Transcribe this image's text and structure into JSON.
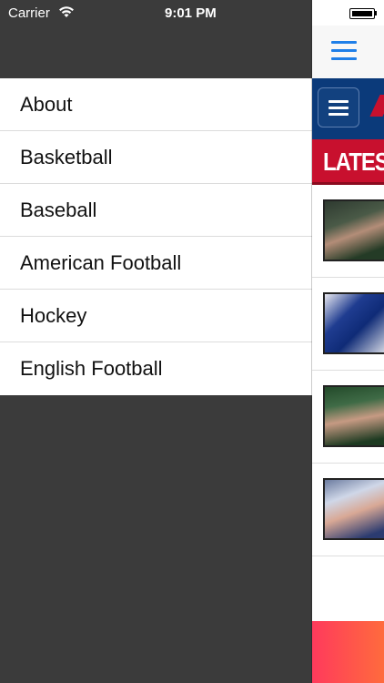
{
  "status_bar": {
    "carrier": "Carrier",
    "time": "9:01 PM"
  },
  "menu": {
    "items": [
      {
        "label": "About"
      },
      {
        "label": "Basketball"
      },
      {
        "label": "Baseball"
      },
      {
        "label": "American Football"
      },
      {
        "label": "Hockey"
      },
      {
        "label": "English Football"
      }
    ]
  },
  "preview": {
    "section_title": "LATEST",
    "colors": {
      "team_blue": "#0b3a7a",
      "team_red": "#c8102e",
      "nav_blue": "#1f7fe8"
    },
    "news_thumbnails": [
      "coach-photo",
      "players-photo",
      "coach-photo",
      "coach-photo"
    ]
  }
}
